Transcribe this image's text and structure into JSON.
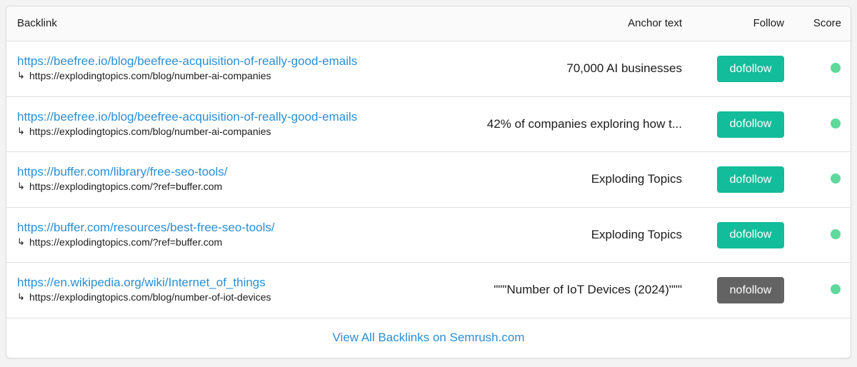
{
  "header": {
    "backlink": "Backlink",
    "anchor": "Anchor text",
    "follow": "Follow",
    "score": "Score"
  },
  "rows": [
    {
      "url": "https://beefree.io/blog/beefree-acquisition-of-really-good-emails",
      "target": "https://explodingtopics.com/blog/number-ai-companies",
      "anchor": "70,000 AI businesses",
      "follow": "dofollow"
    },
    {
      "url": "https://beefree.io/blog/beefree-acquisition-of-really-good-emails",
      "target": "https://explodingtopics.com/blog/number-ai-companies",
      "anchor": "42% of companies exploring how t...",
      "follow": "dofollow"
    },
    {
      "url": "https://buffer.com/library/free-seo-tools/",
      "target": "https://explodingtopics.com/?ref=buffer.com",
      "anchor": "Exploding Topics",
      "follow": "dofollow"
    },
    {
      "url": "https://buffer.com/resources/best-free-seo-tools/",
      "target": "https://explodingtopics.com/?ref=buffer.com",
      "anchor": "Exploding Topics",
      "follow": "dofollow"
    },
    {
      "url": "https://en.wikipedia.org/wiki/Internet_of_things",
      "target": "https://explodingtopics.com/blog/number-of-iot-devices",
      "anchor": "\"\"\"Number of IoT Devices (2024)\"\"\"",
      "follow": "nofollow"
    }
  ],
  "footer": {
    "link": "View All Backlinks on Semrush.com"
  },
  "icons": {
    "redirect_arrow": "↳"
  },
  "colors": {
    "link": "#2a8fd4",
    "dofollow": "#13bc9a",
    "nofollow": "#636363",
    "score": "#5dd99c"
  }
}
